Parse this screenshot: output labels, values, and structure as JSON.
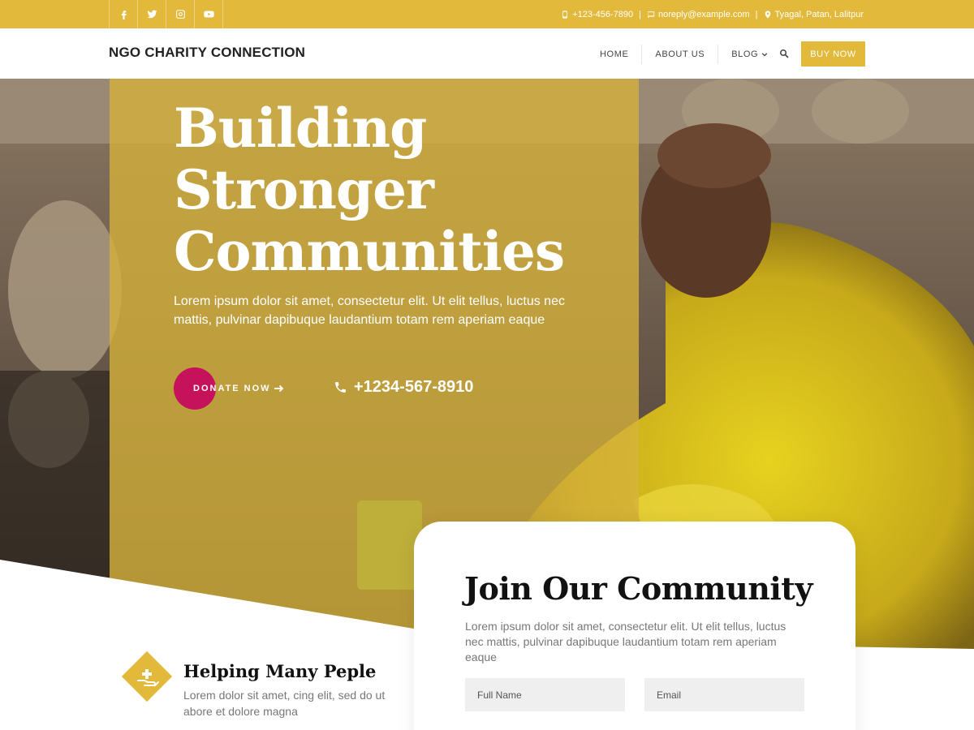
{
  "topbar": {
    "social": [
      "facebook-icon",
      "twitter-icon",
      "instagram-icon",
      "youtube-icon"
    ],
    "phone": "+123-456-7890",
    "email": "noreply@example.com",
    "address": "Tyagal, Patan, Lalitpur"
  },
  "header": {
    "logo": "NGO CHARITY CONNECTION",
    "nav": [
      "HOME",
      "ABOUT US",
      "BLOG"
    ],
    "buy_label": "BUY NOW"
  },
  "hero": {
    "title_lines": [
      "Building",
      "Stronger",
      "Communities"
    ],
    "text": "Lorem ipsum dolor sit amet, consectetur elit. Ut elit tellus, luctus nec mattis, pulvinar dapibuque laudantium totam rem aperiam eaque",
    "donate_label": "DONATE NOW",
    "phone": "+1234-567-8910"
  },
  "join": {
    "title": "Join Our Community",
    "text": "Lorem ipsum dolor sit amet, consectetur elit. Ut elit tellus, luctus nec mattis, pulvinar dapibuque laudantium totam rem aperiam eaque",
    "full_name_placeholder": "Full Name",
    "email_placeholder": "Email"
  },
  "feature": {
    "title": "Helping Many Peple",
    "text": "Lorem dolor sit amet, cing elit, sed do ut abore et dolore magna"
  },
  "colors": {
    "accent": "#e2b93b",
    "donate": "#c5125b"
  }
}
